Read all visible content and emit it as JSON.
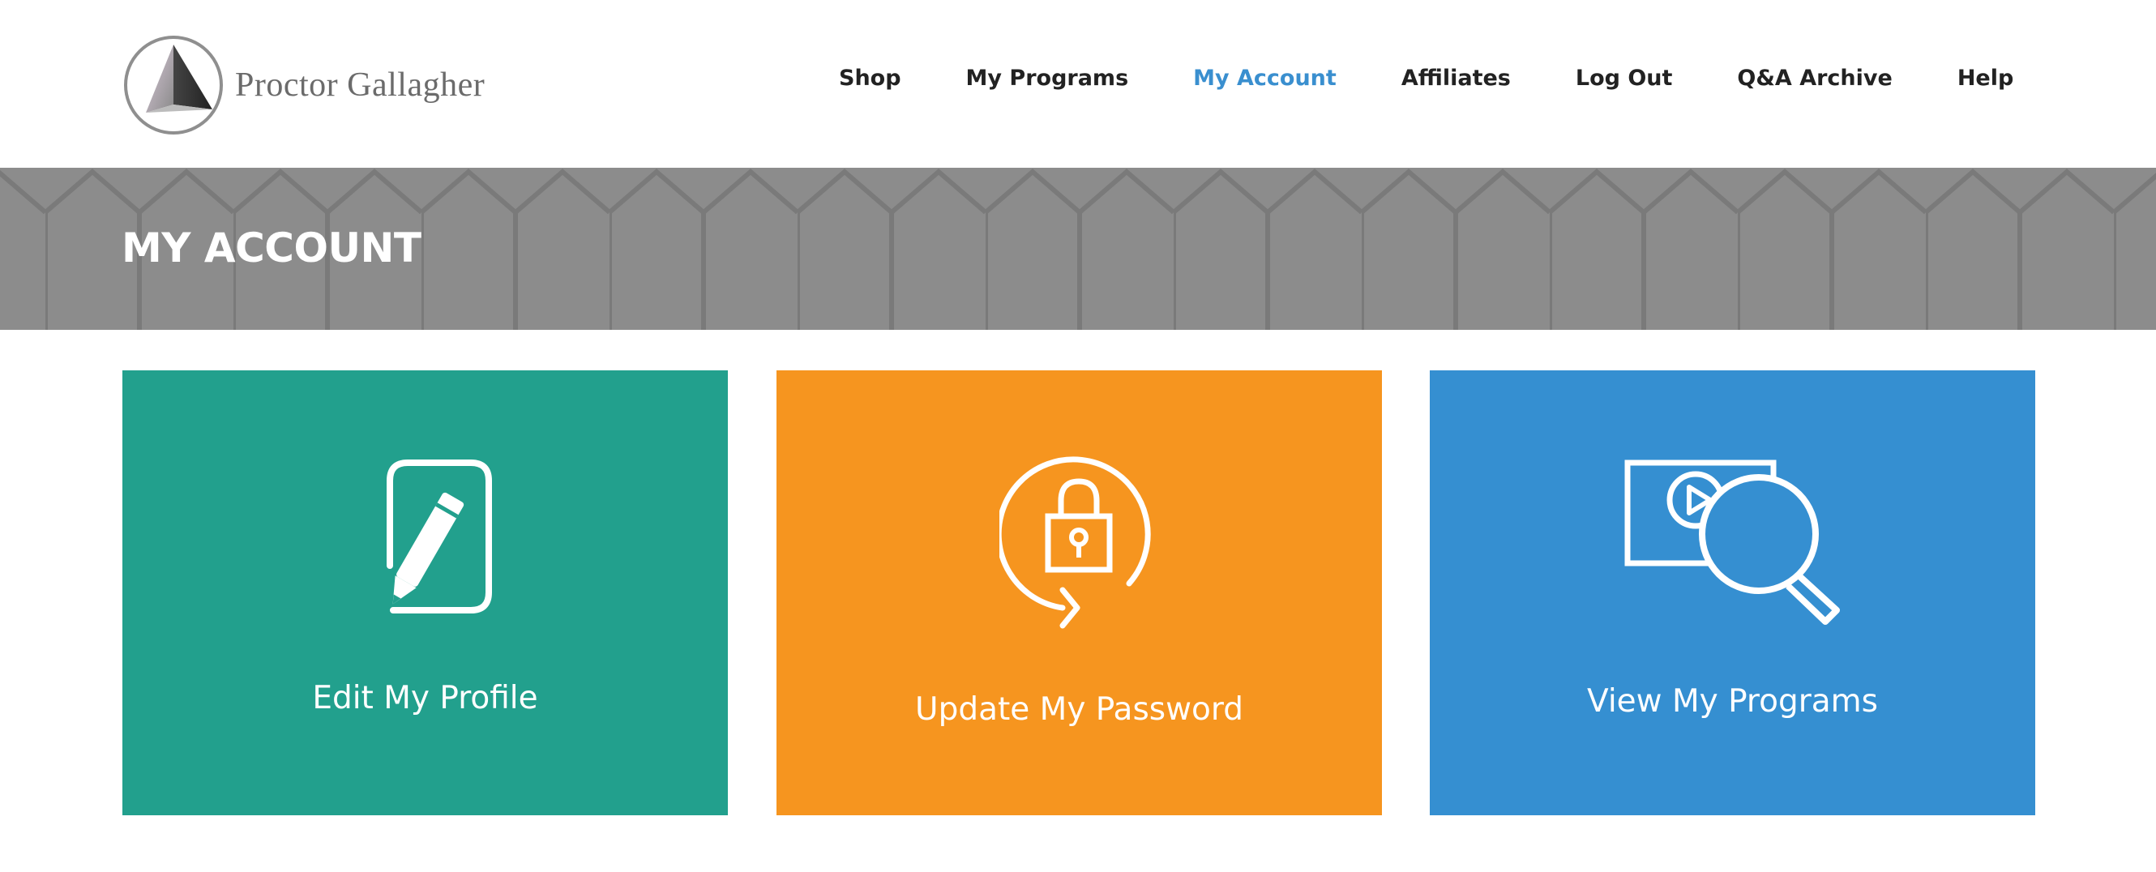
{
  "brand": {
    "name": "Proctor Gallagher",
    "logo_icon": "triangle-logo-icon"
  },
  "nav": {
    "items": [
      {
        "label": "Shop"
      },
      {
        "label": "My Programs"
      },
      {
        "label": "My Account"
      },
      {
        "label": "Affiliates"
      },
      {
        "label": "Log Out"
      },
      {
        "label": "Q&A Archive"
      },
      {
        "label": "Help"
      }
    ],
    "active": "My Account",
    "active_color": "#3a8fcf"
  },
  "banner": {
    "title": "MY ACCOUNT",
    "background": "#8c8c8c"
  },
  "tiles": [
    {
      "label": "Edit My Profile",
      "icon": "edit-pencil-icon",
      "color": "#22a08d"
    },
    {
      "label": "Update My Password",
      "icon": "lock-refresh-icon",
      "color": "#f6951f"
    },
    {
      "label": "View My Programs",
      "icon": "video-search-icon",
      "color": "#358fd1"
    }
  ]
}
